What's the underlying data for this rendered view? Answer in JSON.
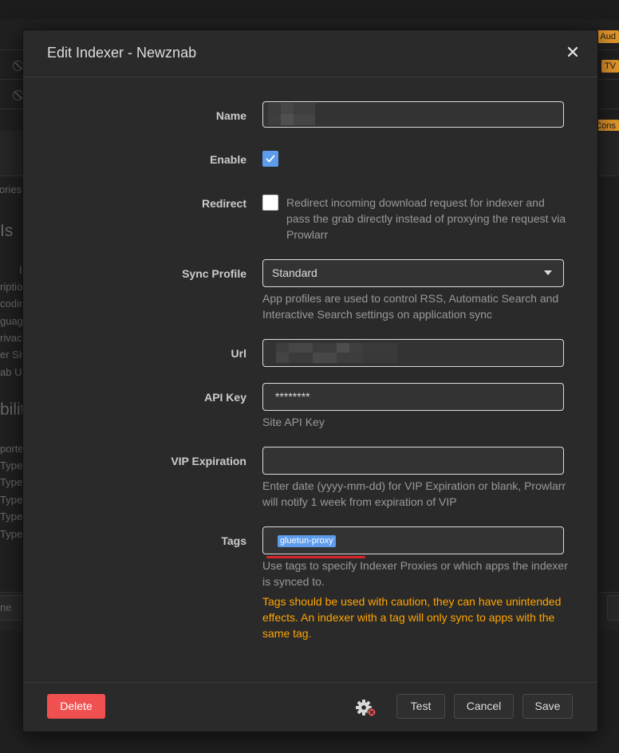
{
  "background": {
    "side_labels": [
      "ories",
      "Is",
      "I",
      "riptio",
      "codin",
      "guag",
      "rivac",
      "er Sit",
      "ab U",
      "bilit",
      "porte",
      "Type",
      "Type",
      "Type",
      "Type",
      "Type",
      "ne"
    ],
    "row_tags": [
      "Aud",
      "TV",
      "Cons"
    ]
  },
  "modal": {
    "title": "Edit Indexer - Newznab",
    "close_icon": "close-icon",
    "fields": {
      "name": {
        "label": "Name",
        "value": ""
      },
      "enable": {
        "label": "Enable",
        "checked": true
      },
      "redirect": {
        "label": "Redirect",
        "checked": false,
        "help": "Redirect incoming download request for indexer and pass the grab directly instead of proxying the request via Prowlarr"
      },
      "sync_profile": {
        "label": "Sync Profile",
        "value": "Standard",
        "help": "App profiles are used to control RSS, Automatic Search and Interactive Search settings on application sync"
      },
      "url": {
        "label": "Url",
        "value": ""
      },
      "api_key": {
        "label": "API Key",
        "value": "********",
        "help": "Site API Key"
      },
      "vip_expiration": {
        "label": "VIP Expiration",
        "value": "",
        "help": "Enter date (yyyy-mm-dd) for VIP Expiration or blank, Prowlarr will notify 1 week from expiration of VIP"
      },
      "tags": {
        "label": "Tags",
        "chips": [
          "gluetun-proxy"
        ],
        "help": "Use tags to specify Indexer Proxies or which apps the indexer is synced to.",
        "warning": "Tags should be used with caution, they can have unintended effects. An indexer with a tag will only sync to apps with the same tag."
      }
    },
    "footer": {
      "delete_label": "Delete",
      "test_label": "Test",
      "cancel_label": "Cancel",
      "save_label": "Save"
    }
  },
  "colors": {
    "accent": "#5d9cec",
    "danger": "#f05050",
    "warning": "#ffa500",
    "annotation": "#d9262b"
  }
}
